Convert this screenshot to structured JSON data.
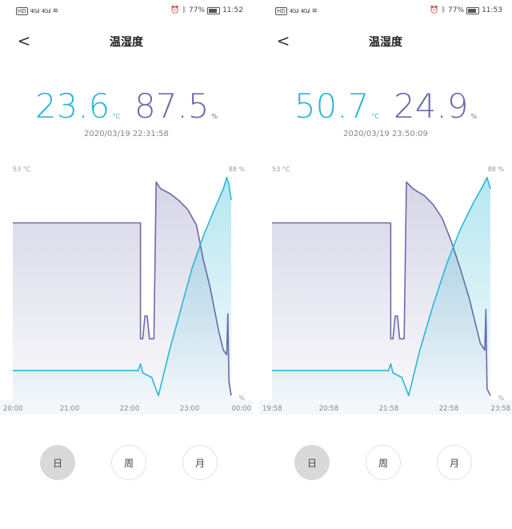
{
  "screens": [
    {
      "statusbar": {
        "left_text": "HD",
        "signal_1": "4G.ıl",
        "signal_2": "4G.ıl",
        "wifi": "wifi-icon",
        "battery_percent": "77%",
        "time": "11:52"
      },
      "header": {
        "back_label": "<",
        "title": "温湿度"
      },
      "reading": {
        "temperature": "23.6",
        "temperature_unit": "°C",
        "humidity": "87.5",
        "humidity_unit": "%",
        "timestamp": "2020/03/19 22:31:58"
      },
      "chart_data": {
        "type": "line",
        "y_left_label": "53 °C",
        "y_right_label_top": "88 %",
        "y_right_label_bottom": "%",
        "x_ticks": [
          "20:00",
          "21:00",
          "22:00",
          "23:00",
          "00:00"
        ],
        "series": [
          {
            "color": "#6b6aaa",
            "points": [
              [
                0,
                0.78
              ],
              [
                0.57,
                0.78
              ],
              [
                0.57,
                0.27
              ],
              [
                0.58,
                0.27
              ],
              [
                0.59,
                0.37
              ],
              [
                0.6,
                0.37
              ],
              [
                0.61,
                0.27
              ],
              [
                0.63,
                0.27
              ],
              [
                0.64,
                0.96
              ],
              [
                0.66,
                0.93
              ],
              [
                0.7,
                0.91
              ],
              [
                0.74,
                0.88
              ],
              [
                0.78,
                0.84
              ],
              [
                0.82,
                0.77
              ],
              [
                0.85,
                0.62
              ],
              [
                0.88,
                0.5
              ],
              [
                0.9,
                0.4
              ],
              [
                0.92,
                0.3
              ],
              [
                0.94,
                0.22
              ],
              [
                0.955,
                0.2
              ],
              [
                0.96,
                0.38
              ],
              [
                0.965,
                0.08
              ],
              [
                0.975,
                0.02
              ]
            ]
          },
          {
            "color": "#2cb8d4",
            "points": [
              [
                0,
                0.13
              ],
              [
                0.56,
                0.13
              ],
              [
                0.57,
                0.16
              ],
              [
                0.58,
                0.12
              ],
              [
                0.62,
                0.1
              ],
              [
                0.65,
                0.02
              ],
              [
                0.7,
                0.22
              ],
              [
                0.75,
                0.4
              ],
              [
                0.8,
                0.58
              ],
              [
                0.85,
                0.72
              ],
              [
                0.9,
                0.84
              ],
              [
                0.94,
                0.93
              ],
              [
                0.955,
                0.98
              ],
              [
                0.965,
                0.95
              ],
              [
                0.975,
                0.88
              ]
            ]
          }
        ]
      },
      "tabs": [
        {
          "label": "日",
          "active": true
        },
        {
          "label": "周",
          "active": false
        },
        {
          "label": "月",
          "active": false
        }
      ]
    },
    {
      "statusbar": {
        "left_text": "HD",
        "signal_1": "4G.ıl",
        "signal_2": "4G.ıl",
        "wifi": "wifi-icon",
        "battery_percent": "77%",
        "time": "11:53"
      },
      "header": {
        "back_label": "<",
        "title": "温湿度"
      },
      "reading": {
        "temperature": "50.7",
        "temperature_unit": "°C",
        "humidity": "24.9",
        "humidity_unit": "%",
        "timestamp": "2020/03/19 23:50:09"
      },
      "chart_data": {
        "type": "line",
        "y_left_label": "53 °C",
        "y_right_label_top": "88 %",
        "y_right_label_bottom": "%",
        "x_ticks": [
          "19:58",
          "20:58",
          "21:58",
          "22:58",
          "23:58"
        ],
        "series": [
          {
            "color": "#6b6aaa",
            "points": [
              [
                0,
                0.78
              ],
              [
                0.53,
                0.78
              ],
              [
                0.53,
                0.27
              ],
              [
                0.54,
                0.27
              ],
              [
                0.55,
                0.37
              ],
              [
                0.56,
                0.37
              ],
              [
                0.57,
                0.27
              ],
              [
                0.59,
                0.27
              ],
              [
                0.6,
                0.96
              ],
              [
                0.63,
                0.93
              ],
              [
                0.68,
                0.9
              ],
              [
                0.72,
                0.86
              ],
              [
                0.76,
                0.8
              ],
              [
                0.8,
                0.7
              ],
              [
                0.84,
                0.58
              ],
              [
                0.88,
                0.45
              ],
              [
                0.91,
                0.33
              ],
              [
                0.93,
                0.25
              ],
              [
                0.95,
                0.22
              ],
              [
                0.955,
                0.4
              ],
              [
                0.96,
                0.05
              ],
              [
                0.975,
                0.02
              ]
            ]
          },
          {
            "color": "#2cb8d4",
            "points": [
              [
                0,
                0.13
              ],
              [
                0.52,
                0.13
              ],
              [
                0.53,
                0.16
              ],
              [
                0.54,
                0.12
              ],
              [
                0.58,
                0.1
              ],
              [
                0.61,
                0.02
              ],
              [
                0.66,
                0.22
              ],
              [
                0.72,
                0.42
              ],
              [
                0.78,
                0.6
              ],
              [
                0.84,
                0.75
              ],
              [
                0.9,
                0.87
              ],
              [
                0.94,
                0.94
              ],
              [
                0.96,
                0.98
              ],
              [
                0.975,
                0.93
              ]
            ]
          }
        ]
      },
      "tabs": [
        {
          "label": "日",
          "active": true
        },
        {
          "label": "周",
          "active": false
        },
        {
          "label": "月",
          "active": false
        }
      ]
    }
  ]
}
